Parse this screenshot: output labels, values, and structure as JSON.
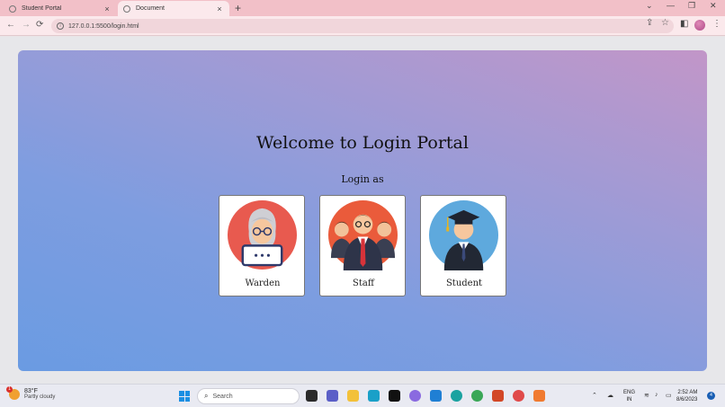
{
  "browser": {
    "tabs": [
      {
        "title": "Student Portal",
        "active": false
      },
      {
        "title": "Document",
        "active": true
      }
    ],
    "new_tab": "+",
    "close_glyph": "×",
    "url": "127.0.0.1:5500/login.html",
    "nav": {
      "back": "←",
      "forward": "→",
      "reload": "⟳"
    },
    "window_controls": {
      "dropdown": "⌄",
      "minimize": "—",
      "restore": "❐",
      "close": "✕"
    }
  },
  "page": {
    "heading": "Welcome to Login Portal",
    "subheading": "Login as",
    "roles": [
      {
        "label": "Warden",
        "icon": "warden-avatar-icon"
      },
      {
        "label": "Staff",
        "icon": "staff-group-icon"
      },
      {
        "label": "Student",
        "icon": "graduate-icon"
      }
    ],
    "colors": {
      "gradient_start": "#c296c8",
      "gradient_end": "#6a9be2"
    }
  },
  "taskbar": {
    "weather": {
      "temp": "83°F",
      "condition": "Partly cloudy",
      "badge": "1"
    },
    "search_placeholder": "Search",
    "language": {
      "line1": "ENG",
      "line2": "IN"
    },
    "clock": {
      "time": "2:52 AM",
      "date": "8/6/2023"
    },
    "notification_count": "4"
  }
}
